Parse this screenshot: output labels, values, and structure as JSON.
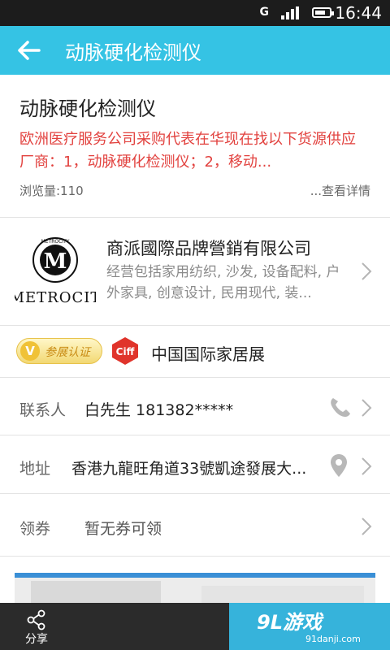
{
  "status_bar": {
    "time": "16:44",
    "signal_label": "G"
  },
  "app_bar": {
    "title": "动脉硬化检测仪"
  },
  "news": {
    "title": "动脉硬化检测仪",
    "description": "欧洲医疗服务公司采购代表在华现在找以下货源供应厂商：1，动脉硬化检测仪；2，移动...",
    "views": "浏览量:110",
    "more": "...查看详情"
  },
  "company": {
    "logo_text": "METROCIT",
    "logo_ring_text": "METROCITY",
    "name": "商派國際品牌營銷有限公司",
    "description": "经营包括家用纺织, 沙发, 设备配料, 户外家具, 创意设计, 民用现代, 装..."
  },
  "exhibition": {
    "badge_label": "参展认证",
    "badge_icon": "V",
    "logo_text": "Ciff",
    "name": "中国国际家居展"
  },
  "contact": {
    "label": "联系人",
    "value": "白先生 181382*****"
  },
  "address": {
    "label": "地址",
    "value": "香港九龍旺角道33號凱途發展大..."
  },
  "coupon": {
    "label": "领券",
    "value": "暂无券可领"
  },
  "bottom_bar": {
    "share_label": "分享"
  },
  "watermark": {
    "brand": "9L游戏",
    "domain": "91danji.com"
  },
  "colors": {
    "accent": "#35c3e4",
    "alert_text": "#e2423f",
    "bottom_bar": "#2b2b2b"
  }
}
